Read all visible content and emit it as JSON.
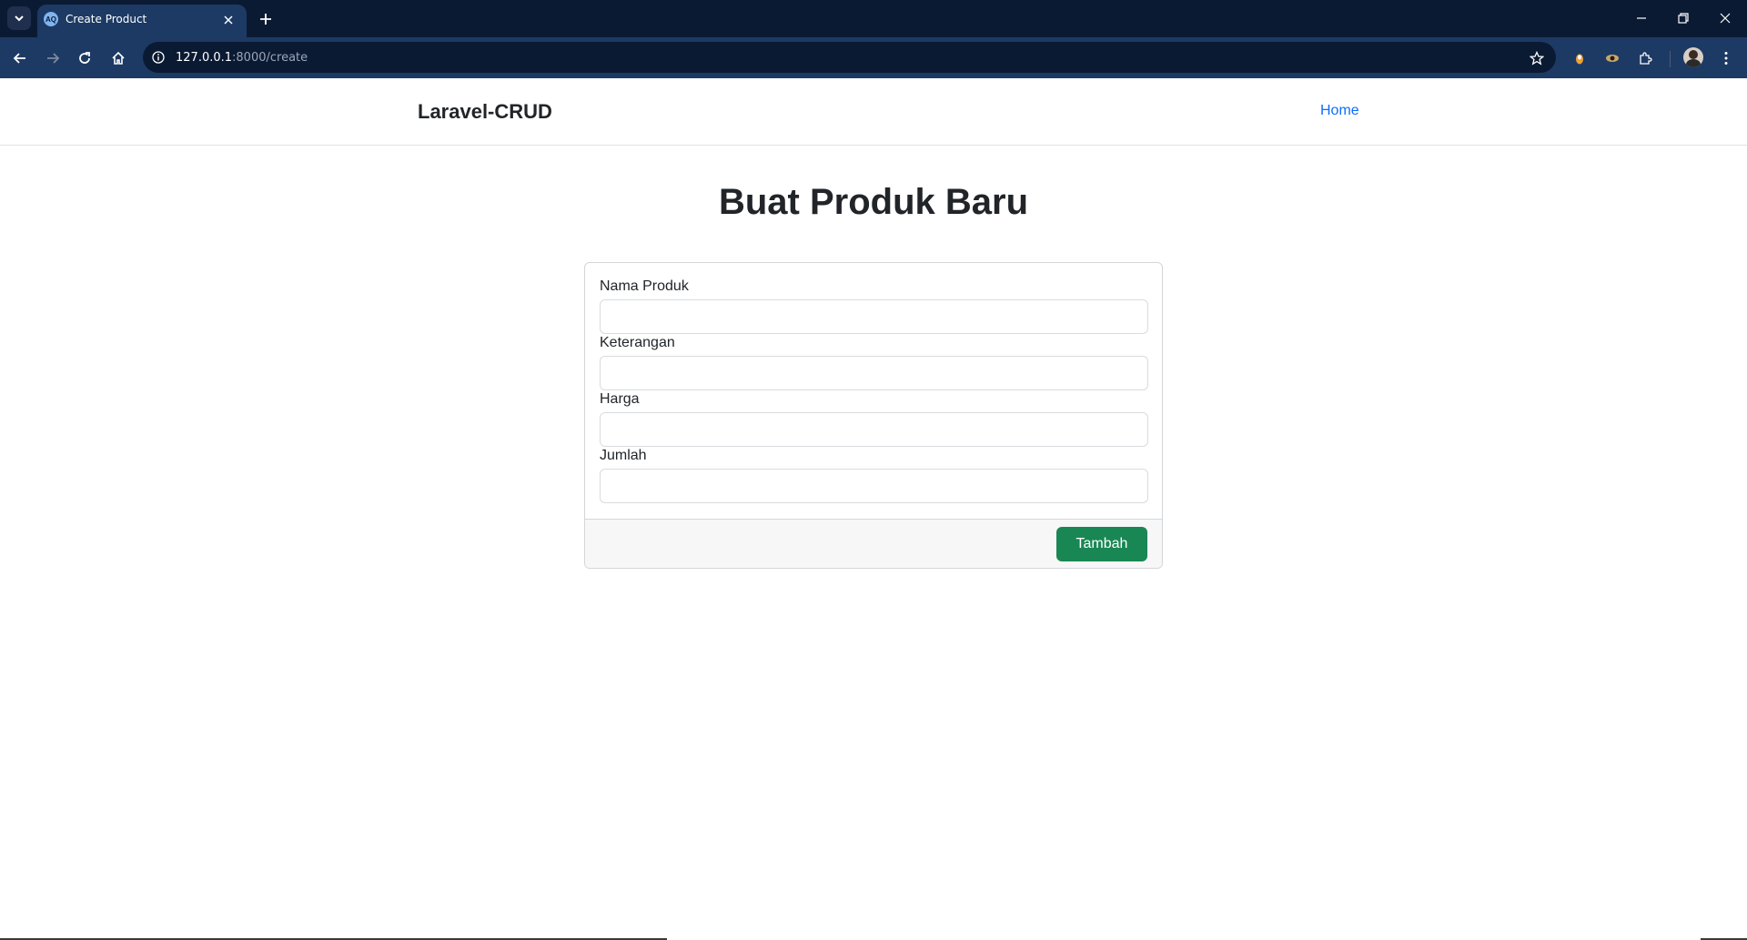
{
  "browser": {
    "tab_title": "Create Product",
    "tab_favicon_text": "AQ",
    "url_host": "127.0.0.1",
    "url_rest": ":8000/create",
    "icons": {
      "tab_search": "chevron-down-icon",
      "tab_close": "close-icon",
      "new_tab": "plus-icon",
      "back": "arrow-left-icon",
      "forward": "arrow-right-icon",
      "reload": "reload-icon",
      "home": "home-icon",
      "site_info": "info-icon",
      "bookmark": "star-icon",
      "extensions": "puzzle-icon",
      "menu": "kebab-menu-icon"
    },
    "colors": {
      "tabbar": "#0b1a33",
      "toolbar": "#1d3a64"
    }
  },
  "navbar": {
    "brand": "Laravel-CRUD",
    "home_link": "Home"
  },
  "page": {
    "title": "Buat Produk Baru"
  },
  "form": {
    "fields": [
      {
        "label": "Nama Produk",
        "value": ""
      },
      {
        "label": "Keterangan",
        "value": ""
      },
      {
        "label": "Harga",
        "value": ""
      },
      {
        "label": "Jumlah",
        "value": ""
      }
    ],
    "submit_label": "Tambah"
  },
  "colors": {
    "primary_link": "#0d6efd",
    "success_button": "#198754"
  }
}
